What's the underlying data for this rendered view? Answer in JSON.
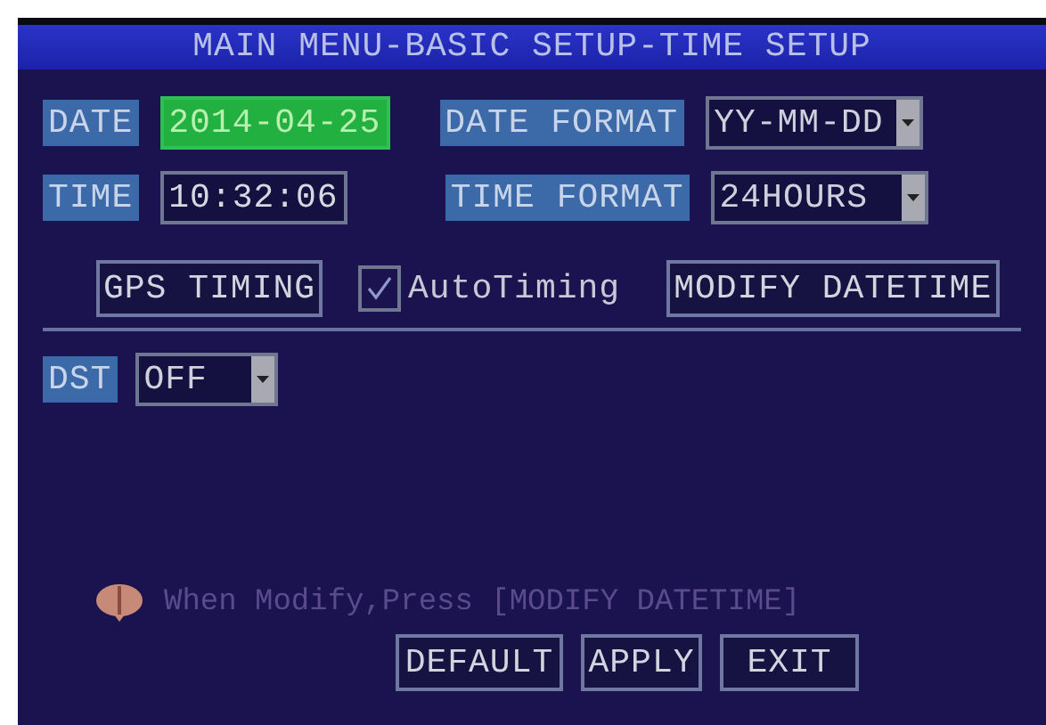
{
  "title": "MAIN MENU-BASIC SETUP-TIME SETUP",
  "date": {
    "label": "DATE",
    "value": "2014-04-25",
    "focused": true
  },
  "date_format": {
    "label": "DATE FORMAT",
    "value": "YY-MM-DD"
  },
  "time": {
    "label": "TIME",
    "value": "10:32:06",
    "focused": false
  },
  "time_format": {
    "label": "TIME FORMAT",
    "value": "24HOURS"
  },
  "gps_button": "GPS TIMING",
  "auto_timing": {
    "label": "AutoTiming",
    "checked": true
  },
  "modify_button": "MODIFY DATETIME",
  "dst": {
    "label": "DST",
    "value": "OFF"
  },
  "hint": "When Modify,Press [MODIFY DATETIME]",
  "buttons": [
    "DEFAULT",
    "APPLY",
    "EXIT"
  ]
}
